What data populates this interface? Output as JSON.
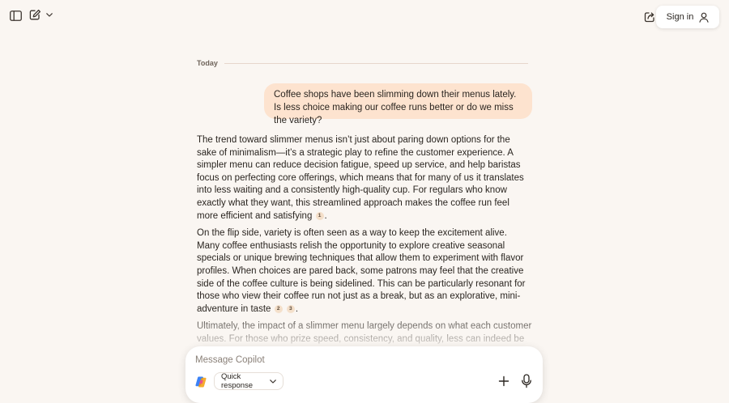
{
  "header": {
    "signin_label": "Sign in",
    "icons": [
      "sidebar-toggle-icon",
      "new-chat-icon",
      "chevron-down-icon",
      "share-icon",
      "user-icon"
    ]
  },
  "conversation": {
    "day_label": "Today",
    "user_message": "Coffee shops have been slimming down their menus lately. Is less choice making our coffee runs better or do we miss the variety?",
    "answer": {
      "p1": "The trend toward slimmer menus isn’t just about paring down options for the sake of minimalism—it’s a strategic play to refine the customer experience. A simpler menu can reduce decision fatigue, speed up service, and help baristas focus on perfecting core offerings, which means that for many of us it translates into less waiting and a consistently high-quality cup. For regulars who know exactly what they want, this streamlined approach makes the coffee run feel more efficient and satisfying",
      "p1_cite": "1",
      "p2": "On the flip side, variety is often seen as a way to keep the excitement alive. Many coffee enthusiasts relish the opportunity to explore creative seasonal specials or unique brewing techniques that allow them to experiment with flavor profiles. When choices are pared back, some patrons may feel that the creative side of the coffee culture is being sidelined. This can be particularly resonant for those who view their coffee run not just as a break, but as an explorative, mini-adventure in taste",
      "p2_cite_a": "2",
      "p2_cite_b": "3",
      "p3": "Ultimately, the impact of a slimmer menu largely depends on what each customer values. For those who prize speed, consistency, and quality, less can indeed be more. Yet, for adventurers at heart—those who see every visit as a chance to try something new—the reduced variety might feel a bit limiting. A balanced approach is emerging: coffee shops",
      "period": "."
    }
  },
  "composer": {
    "placeholder": "Message Copilot",
    "value": "",
    "mode_label": "Quick response"
  },
  "colors": {
    "background": "#faf6f2",
    "user_bubble": "#fde3cf",
    "citation_badge": "#f4dfc9"
  }
}
